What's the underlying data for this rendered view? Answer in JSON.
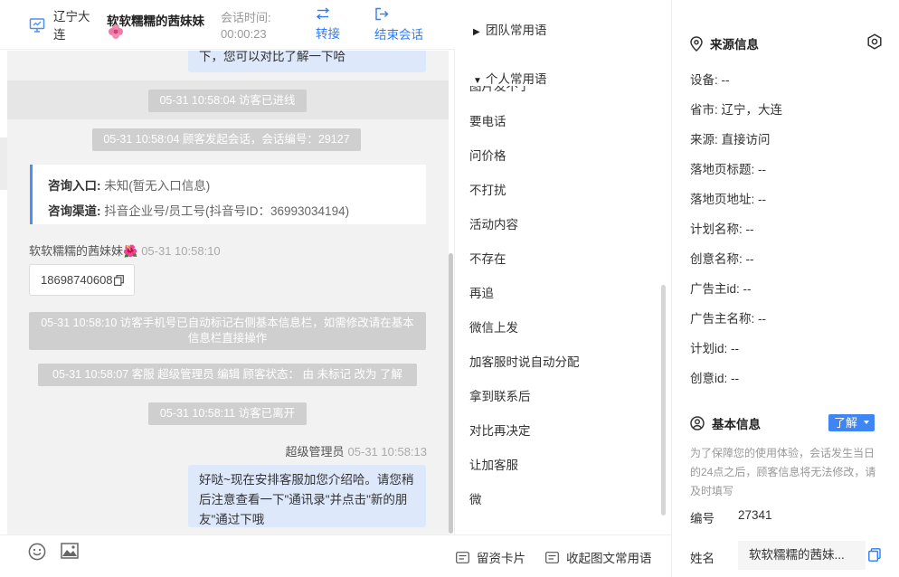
{
  "header": {
    "region": "辽宁大连",
    "visitor_name": "软软糯糯的茜妹妹",
    "session_time_label": "会话时间:",
    "session_time": "00:00:23",
    "transfer_label": "转接",
    "end_label": "结束会话"
  },
  "messages": {
    "prev_bubble_tail": "下，您可以对比了解一下哈",
    "sys1": "05-31 10:58:04 访客已进线",
    "sys2": "05-31 10:58:04 顾客发起会话，会话编号：29127",
    "card_entry_label": "咨询入口:",
    "card_entry_value": " 未知(暂无入口信息)",
    "card_channel_label": "咨询渠道:",
    "card_channel_value": " 抖音企业号/员工号(抖音号ID：36993034194)",
    "visitor_sender": "软软糯糯的茜妹妹🌺",
    "visitor_time": "05-31 10:58:10",
    "phone": "18698740608",
    "sys3": "05-31 10:58:10 访客手机号已自动标记右侧基本信息栏，如需修改请在基本信息栏直接操作",
    "sys4": "05-31 10:58:07 客服 超级管理员 编辑 顾客状态： 由 未标记 改为 了解",
    "sys5": "05-31 10:58:11 访客已离开",
    "agent_sender": "超级管理员",
    "agent_time": "05-31 10:58:13",
    "agent_bubble": "好哒~现在安排客服加您介绍哈。请您稍后注意查看一下\"通讯录\"并点击\"新的朋友\"通过下哦"
  },
  "phrases": {
    "team_group": "团队常用语",
    "personal_group": "个人常用语",
    "clipped_item": "图片发不了",
    "items": [
      "要电话",
      "问价格",
      "不打扰",
      "活动内容",
      "不存在",
      "再追",
      "微信上发",
      "加客服时说自动分配",
      "拿到联系后",
      "对比再决定",
      "让加客服",
      "微"
    ],
    "bottom_card": "留资卡片",
    "bottom_collapse": "收起图文常用语"
  },
  "info": {
    "source_title": "来源信息",
    "fields": [
      "设备: --",
      "省市: 辽宁，大连",
      "来源: 直接访问",
      "落地页标题: --",
      "落地页地址: --",
      "计划名称: --",
      "创意名称: --",
      "广告主id: --",
      "广告主名称: --",
      "计划id: --",
      "创意id: --"
    ],
    "basic_title": "基本信息",
    "learn_label": "了解",
    "note": "为了保障您的使用体验，会话发生当日的24点之后，顾客信息将无法修改，请及时填写",
    "id_label": "编号",
    "id_value": "27341",
    "name_label": "姓名",
    "name_value": "软软糯糯的茜妹..."
  },
  "colors": {
    "accent": "#2f7cf6",
    "bubble": "#dde8fb",
    "system": "#cfcfcf"
  }
}
